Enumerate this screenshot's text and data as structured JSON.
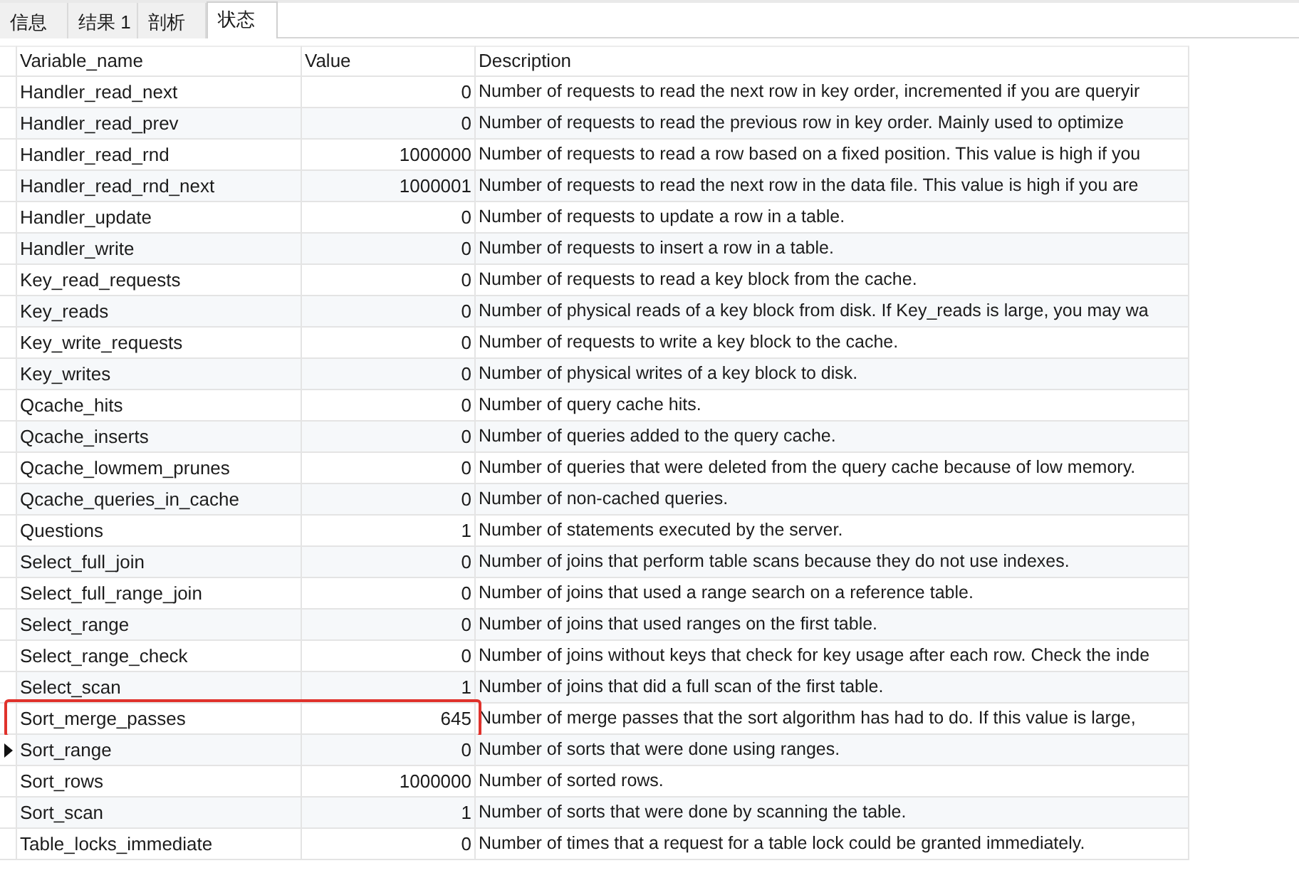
{
  "tabs": [
    {
      "label": "信息",
      "selected": false
    },
    {
      "label": "结果 1",
      "selected": false
    },
    {
      "label": "剖析",
      "selected": false
    },
    {
      "label": "状态",
      "selected": true
    }
  ],
  "table": {
    "columns": [
      "Variable_name",
      "Value",
      "Description"
    ],
    "rows": [
      {
        "cells": [
          "Handler_read_next",
          "0",
          "Number of requests to read the next row in key order, incremented if you are queryir"
        ],
        "current": false,
        "highlighted": false
      },
      {
        "cells": [
          "Handler_read_prev",
          "0",
          "Number of requests to read the previous row in key order. Mainly used to optimize"
        ],
        "current": false,
        "highlighted": false
      },
      {
        "cells": [
          "Handler_read_rnd",
          "1000000",
          "Number of requests to read a row based on a fixed position. This value is high if you"
        ],
        "current": false,
        "highlighted": false
      },
      {
        "cells": [
          "Handler_read_rnd_next",
          "1000001",
          "Number of requests to read the next row in the data file. This value is high if you are"
        ],
        "current": false,
        "highlighted": false
      },
      {
        "cells": [
          "Handler_update",
          "0",
          "Number of requests to update a row in a table."
        ],
        "current": false,
        "highlighted": false
      },
      {
        "cells": [
          "Handler_write",
          "0",
          "Number of requests to insert a row in a table."
        ],
        "current": false,
        "highlighted": false
      },
      {
        "cells": [
          "Key_read_requests",
          "0",
          "Number of requests to read a key block from the cache."
        ],
        "current": false,
        "highlighted": false
      },
      {
        "cells": [
          "Key_reads",
          "0",
          "Number of physical reads of a key block from disk. If Key_reads is large, you may wa"
        ],
        "current": false,
        "highlighted": false
      },
      {
        "cells": [
          "Key_write_requests",
          "0",
          "Number of requests to write a key block to the cache."
        ],
        "current": false,
        "highlighted": false
      },
      {
        "cells": [
          "Key_writes",
          "0",
          "Number of physical writes of a key block to disk."
        ],
        "current": false,
        "highlighted": false
      },
      {
        "cells": [
          "Qcache_hits",
          "0",
          "Number of query cache hits."
        ],
        "current": false,
        "highlighted": false
      },
      {
        "cells": [
          "Qcache_inserts",
          "0",
          "Number of queries added to the query cache."
        ],
        "current": false,
        "highlighted": false
      },
      {
        "cells": [
          "Qcache_lowmem_prunes",
          "0",
          "Number of queries that were deleted from the query cache because of low memory."
        ],
        "current": false,
        "highlighted": false
      },
      {
        "cells": [
          "Qcache_queries_in_cache",
          "0",
          "Number of non-cached queries."
        ],
        "current": false,
        "highlighted": false
      },
      {
        "cells": [
          "Questions",
          "1",
          "Number of statements executed by the server."
        ],
        "current": false,
        "highlighted": false
      },
      {
        "cells": [
          "Select_full_join",
          "0",
          "Number of joins that perform table scans because they do not use indexes."
        ],
        "current": false,
        "highlighted": false
      },
      {
        "cells": [
          "Select_full_range_join",
          "0",
          "Number of joins that used a range search on a reference table."
        ],
        "current": false,
        "highlighted": false
      },
      {
        "cells": [
          "Select_range",
          "0",
          "Number of joins that used ranges on the first table."
        ],
        "current": false,
        "highlighted": false
      },
      {
        "cells": [
          "Select_range_check",
          "0",
          "Number of joins without keys that check for key usage after each row. Check the inde"
        ],
        "current": false,
        "highlighted": false
      },
      {
        "cells": [
          "Select_scan",
          "1",
          "Number of joins that did a full scan of the first table."
        ],
        "current": false,
        "highlighted": false
      },
      {
        "cells": [
          "Sort_merge_passes",
          "645",
          "Number of merge passes that the sort algorithm has had to do. If this value is large,"
        ],
        "current": false,
        "highlighted": true
      },
      {
        "cells": [
          "Sort_range",
          "0",
          "Number of sorts that were done using ranges."
        ],
        "current": true,
        "highlighted": false
      },
      {
        "cells": [
          "Sort_rows",
          "1000000",
          "Number of sorted rows."
        ],
        "current": false,
        "highlighted": false
      },
      {
        "cells": [
          "Sort_scan",
          "1",
          "Number of sorts that were done by scanning the table."
        ],
        "current": false,
        "highlighted": false
      },
      {
        "cells": [
          "Table_locks_immediate",
          "0",
          "Number of times that a request for a table lock could be granted immediately."
        ],
        "current": false,
        "highlighted": false
      }
    ]
  }
}
